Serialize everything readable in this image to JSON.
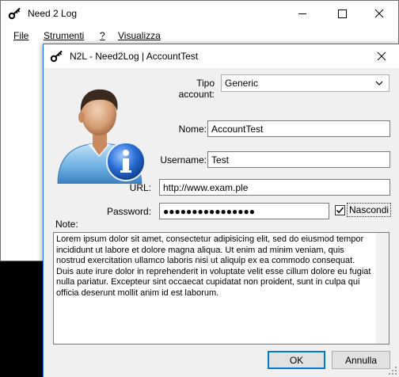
{
  "main_window": {
    "title": "Need 2 Log",
    "menu": [
      "File",
      "Strumenti",
      "?",
      "Visualizza"
    ]
  },
  "dialog": {
    "title": "N2L - Need2Log | AccountTest",
    "fields": {
      "account_type": {
        "label": "Tipo account:",
        "value": "Generic"
      },
      "name": {
        "label": "Nome:",
        "value": "AccountTest"
      },
      "username": {
        "label": "Username:",
        "value": "Test"
      },
      "url": {
        "label": "URL:",
        "value": "http://www.exam.ple"
      },
      "password": {
        "label": "Password:",
        "value": "●●●●●●●●●●●●●●●●"
      }
    },
    "hide_checkbox": {
      "label": "Nascondi",
      "checked": true
    },
    "note_label": "Note:",
    "note_text": "Lorem ipsum dolor sit amet, consectetur adipisicing elit, sed do eiusmod tempor incididunt ut labore et dolore magna aliqua. Ut enim ad minim veniam, quis nostrud exercitation ullamco laboris nisi ut aliquip ex ea commodo consequat. Duis aute irure dolor in reprehenderit in voluptate velit esse cillum dolore eu fugiat nulla pariatur. Excepteur sint occaecat cupidatat non proident, sunt in culpa qui officia deserunt mollit anim id est laborum.",
    "buttons": {
      "ok": "OK",
      "cancel": "Annulla"
    }
  },
  "colors": {
    "accent": "#0078d7",
    "info_badge": "#1f66c9"
  },
  "icons": [
    "key-icon",
    "minimize-icon",
    "maximize-icon",
    "close-icon",
    "chevron-down-icon",
    "user-info-avatar",
    "checkmark-icon",
    "resize-grip-icon"
  ]
}
